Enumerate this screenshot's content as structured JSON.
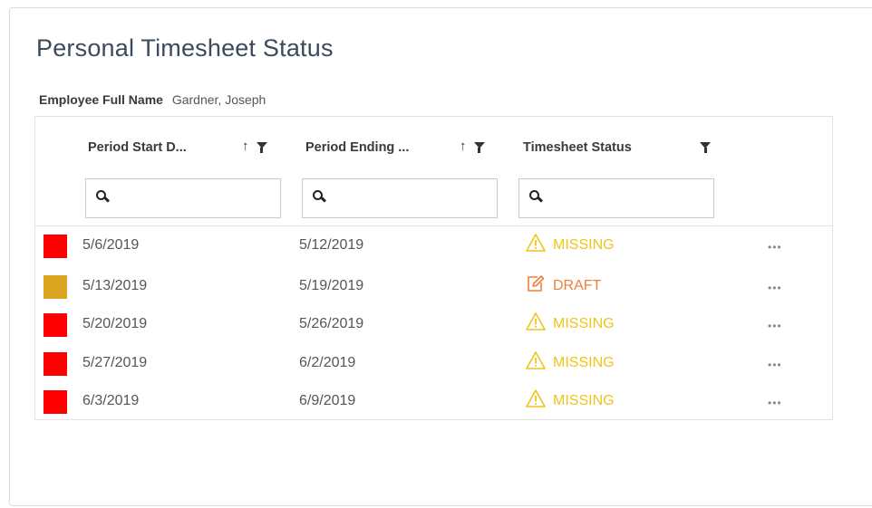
{
  "page": {
    "title": "Personal Timesheet Status"
  },
  "employee": {
    "label": "Employee Full Name",
    "value": "Gardner, Joseph"
  },
  "columns": [
    {
      "label": "Period Start D...",
      "sortable": true,
      "filterable": true
    },
    {
      "label": "Period Ending ...",
      "sortable": true,
      "filterable": true
    },
    {
      "label": "Timesheet Status",
      "sortable": false,
      "filterable": true
    }
  ],
  "filters": [
    {
      "value": "",
      "placeholder": ""
    },
    {
      "value": "",
      "placeholder": ""
    },
    {
      "value": "",
      "placeholder": ""
    }
  ],
  "status_colors": {
    "missing": "#f0c419",
    "draft": "#f07f3c",
    "red": "#ff0000",
    "gold": "#d9a520"
  },
  "rows": [
    {
      "indicator_color": "#ff0000",
      "start": "5/6/2019",
      "end": "5/12/2019",
      "status": "MISSING",
      "status_icon": "warning-icon",
      "actions": "•••"
    },
    {
      "indicator_color": "#d9a520",
      "start": "5/13/2019",
      "end": "5/19/2019",
      "status": "DRAFT",
      "status_icon": "edit-icon",
      "actions": "•••"
    },
    {
      "indicator_color": "#ff0000",
      "start": "5/20/2019",
      "end": "5/26/2019",
      "status": "MISSING",
      "status_icon": "warning-icon",
      "actions": "•••"
    },
    {
      "indicator_color": "#ff0000",
      "start": "5/27/2019",
      "end": "6/2/2019",
      "status": "MISSING",
      "status_icon": "warning-icon",
      "actions": "•••"
    },
    {
      "indicator_color": "#ff0000",
      "start": "6/3/2019",
      "end": "6/9/2019",
      "status": "MISSING",
      "status_icon": "warning-icon",
      "actions": "•••"
    }
  ]
}
